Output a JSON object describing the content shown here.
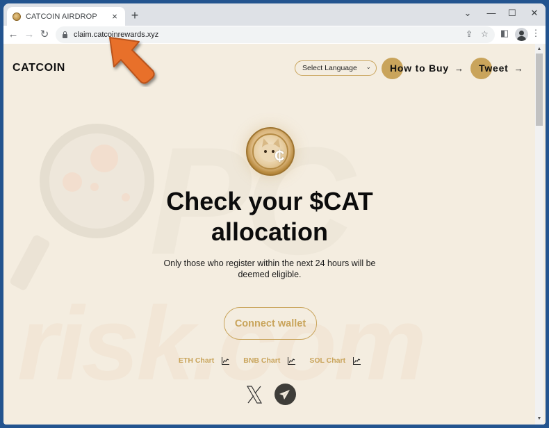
{
  "browser": {
    "tab": {
      "title": "CATCOIN AIRDROP",
      "close_icon": "×"
    },
    "new_tab_icon": "+",
    "window_controls": {
      "tab_search": "⌄",
      "minimize": "—",
      "maximize": "☐",
      "close": "✕"
    },
    "nav": {
      "back": "←",
      "forward": "→",
      "reload": "↻"
    },
    "url": "claim.catcoinrewards.xyz",
    "omnibox_icons": {
      "share": "⇪",
      "bookmark": "☆"
    },
    "toolbar_icons": {
      "side_panel": "◧",
      "menu": "⋮"
    }
  },
  "page": {
    "brand": "CATCOIN",
    "language_select": {
      "selected": "Select Language",
      "chevron": "⌄"
    },
    "nav_links": [
      {
        "label": "How to Buy",
        "arrow": "→"
      },
      {
        "label": "Tweet",
        "arrow": "→"
      }
    ],
    "coin_symbol": "₵",
    "headline_line1": "Check your $CAT",
    "headline_line2": "allocation",
    "subtext_line1": "Only those who register within the next 24 hours will be",
    "subtext_line2": "deemed eligible.",
    "connect_button": "Connect wallet",
    "chart_links": [
      {
        "label": "ETH Chart"
      },
      {
        "label": "BNB Chart"
      },
      {
        "label": "SOL Chart"
      }
    ],
    "socials": [
      "x",
      "telegram"
    ]
  },
  "watermark": {
    "text": "risk.com",
    "letters": "PC"
  },
  "colors": {
    "accent_gold": "#c9a45b",
    "page_bg": "#f4ede0",
    "text_dark": "#111111",
    "pointer_orange": "#e8702a",
    "telegram_bg": "#3e3d39"
  }
}
